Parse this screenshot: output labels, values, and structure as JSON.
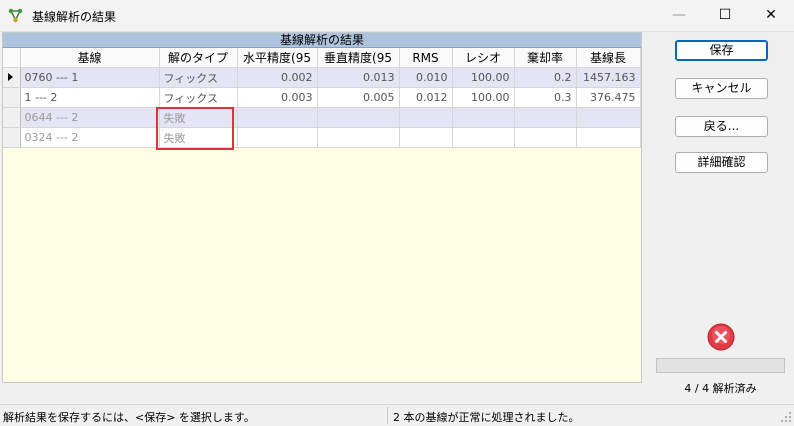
{
  "window": {
    "title": "基線解析の結果",
    "minimize_glyph": "—",
    "maximize_glyph": "☐",
    "close_glyph": "✕"
  },
  "grid": {
    "caption": "基線解析の結果",
    "columns": [
      "基線",
      "解のタイプ",
      "水平精度(95",
      "垂直精度(95",
      "RMS",
      "レシオ",
      "棄却率",
      "基線長"
    ],
    "rows": [
      {
        "baseline": "0760 --- 1",
        "type": "フィックス",
        "horizontal": "0.002",
        "vertical": "0.013",
        "rms": "0.010",
        "ratio": "100.00",
        "reject": "0.2",
        "length": "1457.163"
      },
      {
        "baseline": "1 --- 2",
        "type": "フィックス",
        "horizontal": "0.003",
        "vertical": "0.005",
        "rms": "0.012",
        "ratio": "100.00",
        "reject": "0.3",
        "length": "376.475"
      },
      {
        "baseline": "0644 --- 2",
        "type": "失敗",
        "horizontal": "",
        "vertical": "",
        "rms": "",
        "ratio": "",
        "reject": "",
        "length": ""
      },
      {
        "baseline": "0324 --- 2",
        "type": "失敗",
        "horizontal": "",
        "vertical": "",
        "rms": "",
        "ratio": "",
        "reject": "",
        "length": ""
      }
    ]
  },
  "buttons": {
    "save": "保存",
    "cancel": "キャンセル",
    "back": "戻る...",
    "details": "詳細確認"
  },
  "progress": {
    "label": "4 / 4 解析済み",
    "fraction": 0
  },
  "status": {
    "left": "解析結果を保存するには、<保存> を選択します。",
    "right": "2 本の基線が正常に処理されました。"
  },
  "colors": {
    "caption_bg": "#aec4de",
    "grid_bg": "#ffffe6",
    "highlight": "#e0323c",
    "stop": "#e23b46"
  },
  "icons": {
    "app": "network-nodes-icon",
    "stop": "stop-x-icon",
    "row_pointer": "row-pointer-icon"
  }
}
